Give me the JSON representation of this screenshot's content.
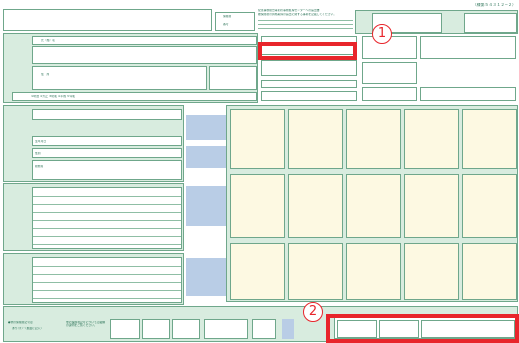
{
  "form": {
    "code": "（様第５４３１２−２）",
    "header_small_1": "配達事務組合等別の事務処理センターへの届出書",
    "header_small_2": "被保険者の資格取得の届出に関する事項を記載してください。",
    "checkbox_label_1": "保険者",
    "checkbox_label_2": "番号",
    "label_name": "氏（姓）名",
    "label_address": "住　所",
    "label_birth": "生年月日",
    "label_gender": "性別",
    "label_kyu": "旧番号",
    "label_era": "①明治 ②大正 ③昭和 ④平成 ⑤令和",
    "label_issue": "資格取得年月日",
    "label_company": "勤務先",
    "label_remarks": "備　考",
    "label_stamp": "整理番号",
    "label_bottom_1": "●他の保険者記号は",
    "label_bottom_2": "あり(ス)・(裏面に記入)",
    "label_bottom_3": "他の保険者記号について記載欄の説明をご覧ください。",
    "label_bottom_4": "被保険者の種別",
    "label_bottom_5": "適用事業所の名称",
    "label_bottom_6": "被保険者数",
    "label_bottom_7": "事業主印",
    "label_mid_code": "届出番号",
    "label_circle": "①",
    "label_circle2": "②",
    "label_circle3": "③"
  },
  "annotations": {
    "badge_1": "1",
    "badge_2": "2"
  },
  "colors": {
    "form_green": "#d8ecdf",
    "cream": "#fdf9e2",
    "blue_block": "#b9cde6",
    "accent_red": "#e8252b"
  }
}
